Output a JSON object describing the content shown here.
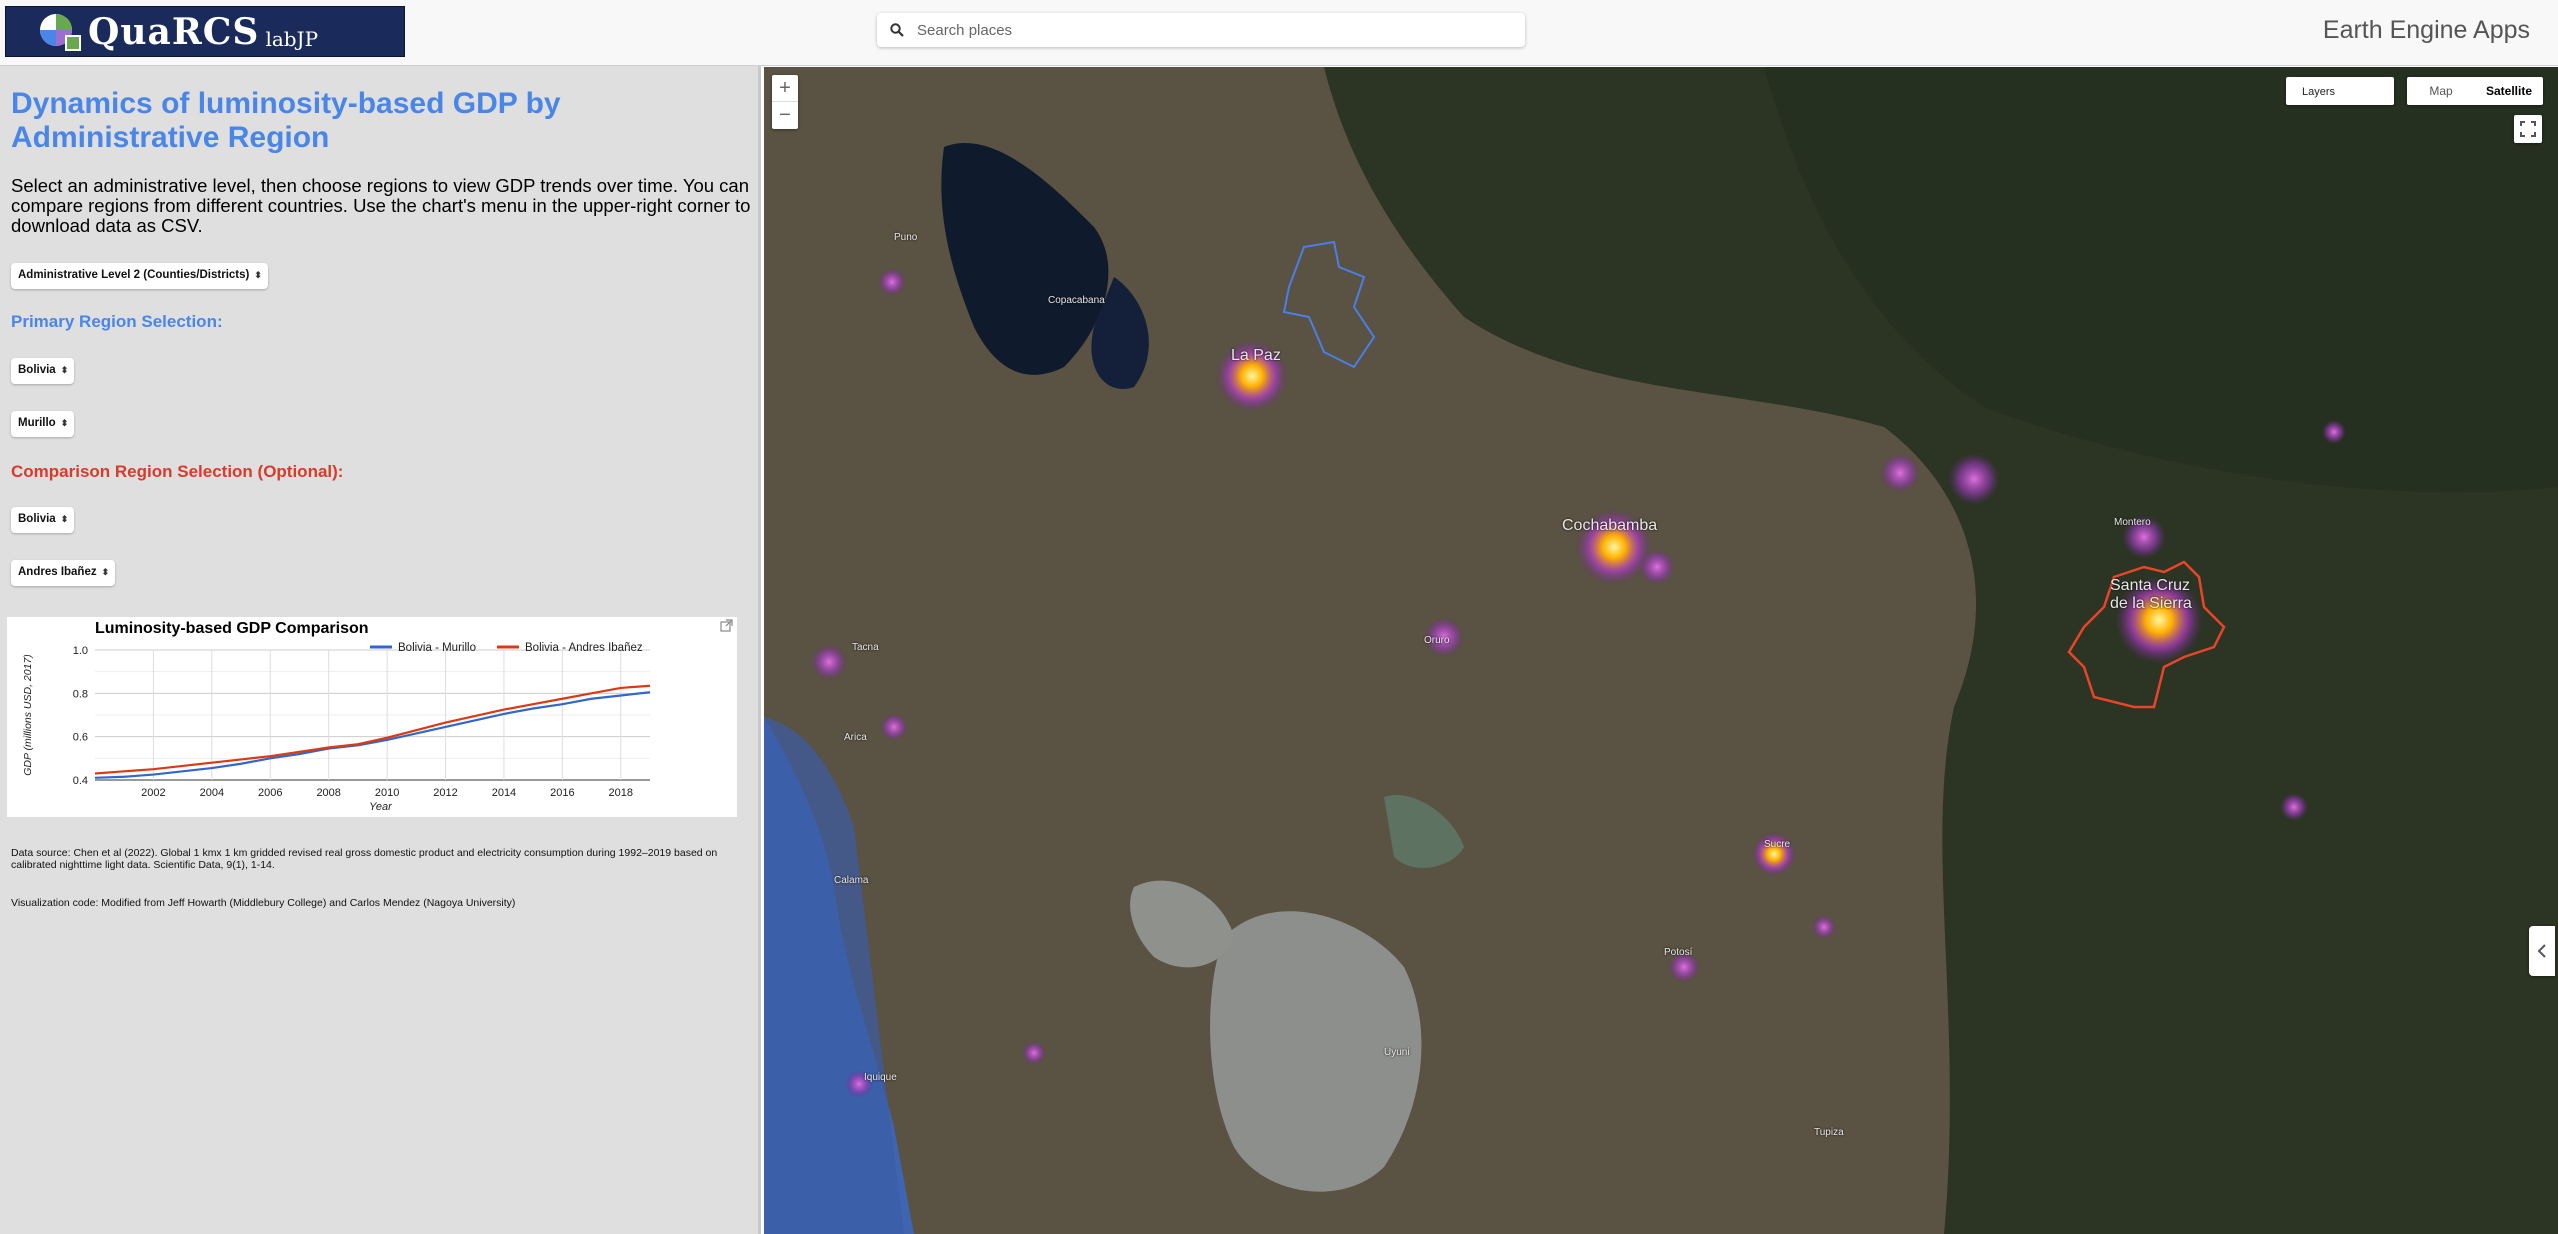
{
  "header": {
    "logo_text": "QuaRCS",
    "logo_sub": "labJP",
    "search_placeholder": "Search places",
    "app_title": "Earth Engine Apps"
  },
  "panel": {
    "title": "Dynamics of luminosity-based GDP by Administrative Region",
    "intro": "Select an administrative level, then choose regions to view GDP trends over time. You can compare regions from different countries. Use the chart's menu in the upper-right corner to download data as CSV.",
    "admin_level": "Administrative Level 2 (Counties/Districts)",
    "primary_label": "Primary Region Selection:",
    "primary_country": "Bolivia",
    "primary_region": "Murillo",
    "comparison_label": "Comparison Region Selection (Optional):",
    "comparison_country": "Bolivia",
    "comparison_region": "Andres Ibañez",
    "data_source": "Data source: Chen et al (2022). Global 1 kmx 1 km gridded revised real gross domestic product and electricity consumption during 1992–2019 based on calibrated nighttime light data. Scientific Data, 9(1), 1-14.",
    "viz_credit": "Visualization code: Modified from Jeff Howarth (Middlebury College) and Carlos Mendez (Nagoya University)"
  },
  "chart_data": {
    "type": "line",
    "title": "Luminosity-based GDP Comparison",
    "xlabel": "Year",
    "ylabel": "GDP (millions USD, 2017)",
    "ylim": [
      0.4,
      1.0
    ],
    "xlim": [
      2000,
      2019
    ],
    "yticks": [
      "0.4",
      "0.6",
      "0.8",
      "1.0"
    ],
    "xticks": [
      "2002",
      "2004",
      "2006",
      "2008",
      "2010",
      "2012",
      "2014",
      "2016",
      "2018"
    ],
    "legend_position": "top-right",
    "grid": true,
    "x": [
      2000,
      2001,
      2002,
      2003,
      2004,
      2005,
      2006,
      2007,
      2008,
      2009,
      2010,
      2011,
      2012,
      2013,
      2014,
      2015,
      2016,
      2017,
      2018,
      2019
    ],
    "series": [
      {
        "name": "Bolivia - Murillo",
        "color": "#3366cc",
        "values": [
          0.41,
          0.415,
          0.425,
          0.44,
          0.455,
          0.475,
          0.5,
          0.52,
          0.545,
          0.56,
          0.585,
          0.615,
          0.645,
          0.675,
          0.705,
          0.73,
          0.75,
          0.775,
          0.79,
          0.805
        ]
      },
      {
        "name": "Bolivia - Andres Ibañez",
        "color": "#dc3912",
        "values": [
          0.43,
          0.44,
          0.45,
          0.465,
          0.48,
          0.495,
          0.51,
          0.53,
          0.55,
          0.565,
          0.595,
          0.63,
          0.665,
          0.695,
          0.725,
          0.75,
          0.775,
          0.8,
          0.825,
          0.835
        ]
      }
    ]
  },
  "map": {
    "zoom_in": "+",
    "zoom_out": "−",
    "layers_label": "Layers",
    "map_label": "Map",
    "satellite_label": "Satellite",
    "labels": [
      {
        "text": "La Paz",
        "big": true
      },
      {
        "text": "Cochabamba",
        "big": true
      },
      {
        "text": "Santa Cruz",
        "big": true
      },
      {
        "text": "de la Sierra",
        "big": true
      },
      {
        "text": "Oruro",
        "big": false
      },
      {
        "text": "Sucre",
        "big": false
      },
      {
        "text": "Potosí",
        "big": false
      },
      {
        "text": "Puno",
        "big": false
      },
      {
        "text": "Arica",
        "big": false
      },
      {
        "text": "Iquique",
        "big": false
      },
      {
        "text": "Tacna",
        "big": false
      },
      {
        "text": "Montero",
        "big": false
      },
      {
        "text": "Tupiza",
        "big": false
      },
      {
        "text": "Uyuni",
        "big": false
      },
      {
        "text": "Copacabana",
        "big": false
      },
      {
        "text": "Calama",
        "big": false
      }
    ]
  }
}
